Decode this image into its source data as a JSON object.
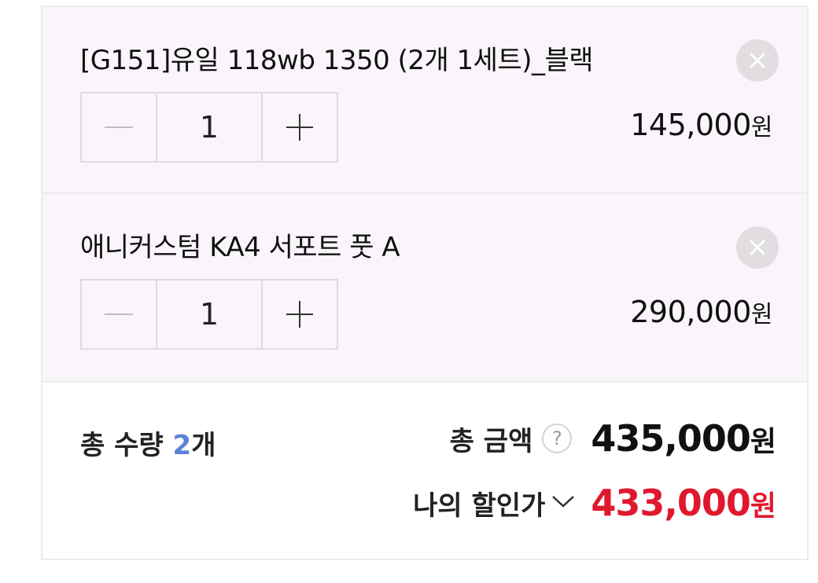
{
  "cart": {
    "items": [
      {
        "name": "[G151]유일 118wb 1350 (2개 1세트)_블랙",
        "quantity": "1",
        "price": "145,000",
        "currency": "원",
        "decrease_icon": "minus-icon",
        "increase_icon": "plus-icon",
        "remove_icon": "close-icon"
      },
      {
        "name": "애니커스텀 KA4 서포트 풋 A",
        "quantity": "1",
        "price": "290,000",
        "currency": "원",
        "decrease_icon": "minus-icon",
        "increase_icon": "plus-icon",
        "remove_icon": "close-icon"
      }
    ]
  },
  "summary": {
    "total_qty_label": "총 수량 ",
    "total_qty_count": "2",
    "total_qty_unit": "개",
    "total_amount_label": "총 금액",
    "help_icon": "?",
    "total_amount": "435,000",
    "total_amount_unit": "원",
    "discount_label": "나의 할인가",
    "discount_amount": "433,000",
    "discount_unit": "원"
  },
  "colors": {
    "item_bg": "#faf5fb",
    "qty_accent": "#5a82d6",
    "discount_red": "#e0182e"
  }
}
